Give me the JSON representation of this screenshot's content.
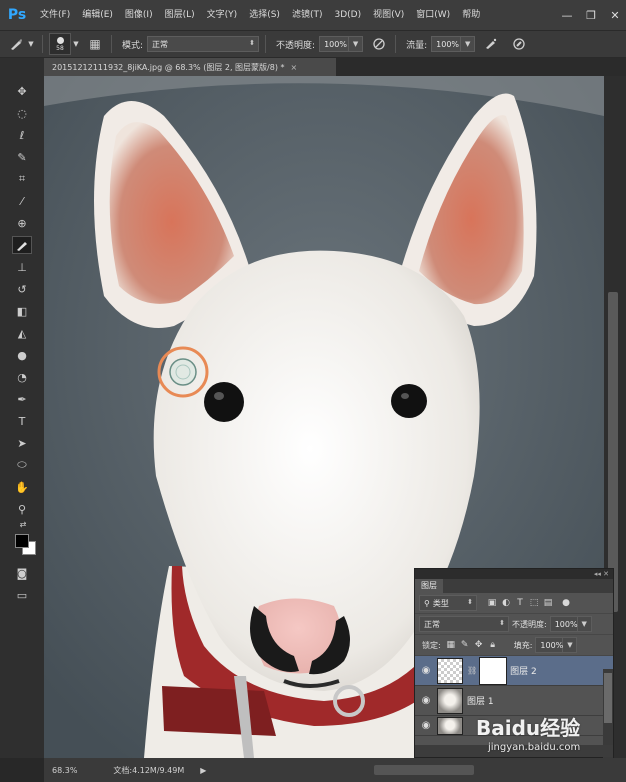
{
  "app": {
    "logo": "Ps",
    "menu": [
      "文件(F)",
      "编辑(E)",
      "图像(I)",
      "图层(L)",
      "文字(Y)",
      "选择(S)",
      "滤镜(T)",
      "3D(D)",
      "视图(V)",
      "窗口(W)",
      "帮助"
    ],
    "window_controls": [
      "minimize-icon",
      "restore-icon",
      "close-icon"
    ]
  },
  "options_bar": {
    "brush_size": "58",
    "mode_label": "模式:",
    "mode_value": "正常",
    "opacity_label": "不透明度:",
    "opacity_value": "100%",
    "flow_label": "流量:",
    "flow_value": "100%"
  },
  "document": {
    "tab_title": "20151212111932_8jiKA.jpg @ 68.3% (图层 2, 图层蒙版/8) *",
    "tab_close": "×"
  },
  "tools": [
    "move-icon",
    "marquee-icon",
    "lasso-icon",
    "quick-select-icon",
    "crop-icon",
    "eyedropper-icon",
    "healing-icon",
    "brush-icon",
    "stamp-icon",
    "history-brush-icon",
    "eraser-icon",
    "paint-bucket-icon",
    "blur-icon",
    "dodge-icon",
    "pen-icon",
    "type-icon",
    "path-select-icon",
    "shape-icon",
    "hand-icon",
    "zoom-icon"
  ],
  "active_tool": "brush-icon",
  "colors": {
    "foreground": "#000000",
    "background": "#ffffff"
  },
  "status_bar": {
    "zoom": "68.3%",
    "doc_size": "文档:4.12M/9.49M",
    "arrow": "▶"
  },
  "layers_panel": {
    "title": "图层",
    "filter_kind": "类型",
    "blend_mode": "正常",
    "opacity_label": "不透明度:",
    "opacity_value": "100%",
    "lock_label": "锁定:",
    "fill_label": "填充:",
    "fill_value": "100%",
    "layers": [
      {
        "name": "图层 2",
        "selected": true
      },
      {
        "name": "图层 1",
        "selected": false
      },
      {
        "name": "",
        "selected": false
      }
    ]
  },
  "watermark": {
    "brand": "Baidu经验",
    "url": "jingyan.baidu.com"
  }
}
